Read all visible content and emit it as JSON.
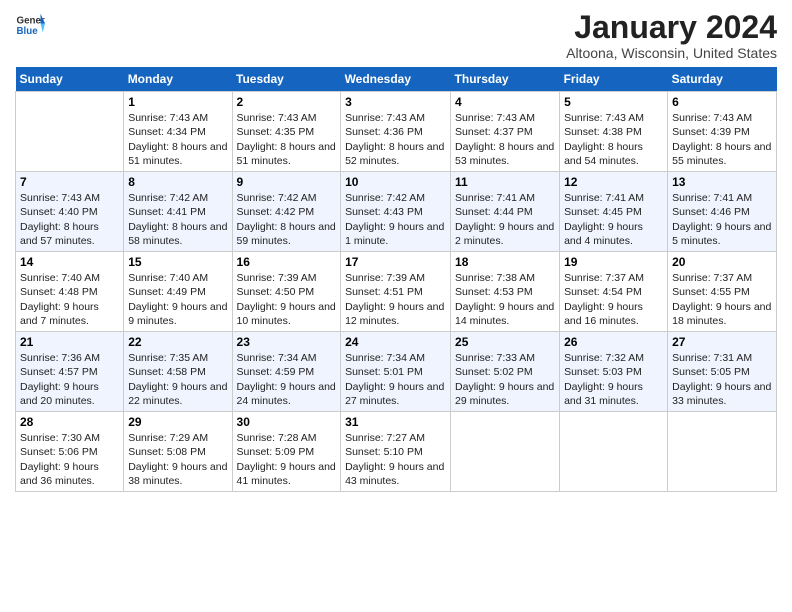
{
  "header": {
    "logo_general": "General",
    "logo_blue": "Blue",
    "title": "January 2024",
    "location": "Altoona, Wisconsin, United States"
  },
  "days_of_week": [
    "Sunday",
    "Monday",
    "Tuesday",
    "Wednesday",
    "Thursday",
    "Friday",
    "Saturday"
  ],
  "weeks": [
    [
      {
        "num": "",
        "sunrise": "",
        "sunset": "",
        "daylight": ""
      },
      {
        "num": "1",
        "sunrise": "7:43 AM",
        "sunset": "4:34 PM",
        "daylight": "8 hours and 51 minutes."
      },
      {
        "num": "2",
        "sunrise": "7:43 AM",
        "sunset": "4:35 PM",
        "daylight": "8 hours and 51 minutes."
      },
      {
        "num": "3",
        "sunrise": "7:43 AM",
        "sunset": "4:36 PM",
        "daylight": "8 hours and 52 minutes."
      },
      {
        "num": "4",
        "sunrise": "7:43 AM",
        "sunset": "4:37 PM",
        "daylight": "8 hours and 53 minutes."
      },
      {
        "num": "5",
        "sunrise": "7:43 AM",
        "sunset": "4:38 PM",
        "daylight": "8 hours and 54 minutes."
      },
      {
        "num": "6",
        "sunrise": "7:43 AM",
        "sunset": "4:39 PM",
        "daylight": "8 hours and 55 minutes."
      }
    ],
    [
      {
        "num": "7",
        "sunrise": "7:43 AM",
        "sunset": "4:40 PM",
        "daylight": "8 hours and 57 minutes."
      },
      {
        "num": "8",
        "sunrise": "7:42 AM",
        "sunset": "4:41 PM",
        "daylight": "8 hours and 58 minutes."
      },
      {
        "num": "9",
        "sunrise": "7:42 AM",
        "sunset": "4:42 PM",
        "daylight": "8 hours and 59 minutes."
      },
      {
        "num": "10",
        "sunrise": "7:42 AM",
        "sunset": "4:43 PM",
        "daylight": "9 hours and 1 minute."
      },
      {
        "num": "11",
        "sunrise": "7:41 AM",
        "sunset": "4:44 PM",
        "daylight": "9 hours and 2 minutes."
      },
      {
        "num": "12",
        "sunrise": "7:41 AM",
        "sunset": "4:45 PM",
        "daylight": "9 hours and 4 minutes."
      },
      {
        "num": "13",
        "sunrise": "7:41 AM",
        "sunset": "4:46 PM",
        "daylight": "9 hours and 5 minutes."
      }
    ],
    [
      {
        "num": "14",
        "sunrise": "7:40 AM",
        "sunset": "4:48 PM",
        "daylight": "9 hours and 7 minutes."
      },
      {
        "num": "15",
        "sunrise": "7:40 AM",
        "sunset": "4:49 PM",
        "daylight": "9 hours and 9 minutes."
      },
      {
        "num": "16",
        "sunrise": "7:39 AM",
        "sunset": "4:50 PM",
        "daylight": "9 hours and 10 minutes."
      },
      {
        "num": "17",
        "sunrise": "7:39 AM",
        "sunset": "4:51 PM",
        "daylight": "9 hours and 12 minutes."
      },
      {
        "num": "18",
        "sunrise": "7:38 AM",
        "sunset": "4:53 PM",
        "daylight": "9 hours and 14 minutes."
      },
      {
        "num": "19",
        "sunrise": "7:37 AM",
        "sunset": "4:54 PM",
        "daylight": "9 hours and 16 minutes."
      },
      {
        "num": "20",
        "sunrise": "7:37 AM",
        "sunset": "4:55 PM",
        "daylight": "9 hours and 18 minutes."
      }
    ],
    [
      {
        "num": "21",
        "sunrise": "7:36 AM",
        "sunset": "4:57 PM",
        "daylight": "9 hours and 20 minutes."
      },
      {
        "num": "22",
        "sunrise": "7:35 AM",
        "sunset": "4:58 PM",
        "daylight": "9 hours and 22 minutes."
      },
      {
        "num": "23",
        "sunrise": "7:34 AM",
        "sunset": "4:59 PM",
        "daylight": "9 hours and 24 minutes."
      },
      {
        "num": "24",
        "sunrise": "7:34 AM",
        "sunset": "5:01 PM",
        "daylight": "9 hours and 27 minutes."
      },
      {
        "num": "25",
        "sunrise": "7:33 AM",
        "sunset": "5:02 PM",
        "daylight": "9 hours and 29 minutes."
      },
      {
        "num": "26",
        "sunrise": "7:32 AM",
        "sunset": "5:03 PM",
        "daylight": "9 hours and 31 minutes."
      },
      {
        "num": "27",
        "sunrise": "7:31 AM",
        "sunset": "5:05 PM",
        "daylight": "9 hours and 33 minutes."
      }
    ],
    [
      {
        "num": "28",
        "sunrise": "7:30 AM",
        "sunset": "5:06 PM",
        "daylight": "9 hours and 36 minutes."
      },
      {
        "num": "29",
        "sunrise": "7:29 AM",
        "sunset": "5:08 PM",
        "daylight": "9 hours and 38 minutes."
      },
      {
        "num": "30",
        "sunrise": "7:28 AM",
        "sunset": "5:09 PM",
        "daylight": "9 hours and 41 minutes."
      },
      {
        "num": "31",
        "sunrise": "7:27 AM",
        "sunset": "5:10 PM",
        "daylight": "9 hours and 43 minutes."
      },
      {
        "num": "",
        "sunrise": "",
        "sunset": "",
        "daylight": ""
      },
      {
        "num": "",
        "sunrise": "",
        "sunset": "",
        "daylight": ""
      },
      {
        "num": "",
        "sunrise": "",
        "sunset": "",
        "daylight": ""
      }
    ]
  ]
}
